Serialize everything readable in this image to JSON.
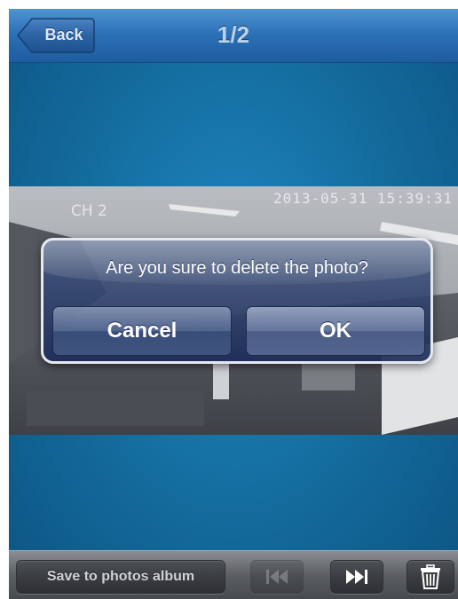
{
  "nav": {
    "back_label": "Back",
    "title": "1/2"
  },
  "photo": {
    "timestamp": "2013-05-31 15:39:31",
    "channel": "CH 2"
  },
  "alert": {
    "message": "Are you sure to delete the photo?",
    "cancel_label": "Cancel",
    "ok_label": "OK"
  },
  "toolbar": {
    "save_label": "Save to photos album",
    "prev_icon": "skip-previous-icon",
    "prev_enabled": false,
    "next_icon": "skip-next-icon",
    "trash_icon": "trash-icon"
  },
  "colors": {
    "navbar": "#2a6fb5",
    "background": "#136a9b",
    "toolbar": "#5b5e62"
  }
}
